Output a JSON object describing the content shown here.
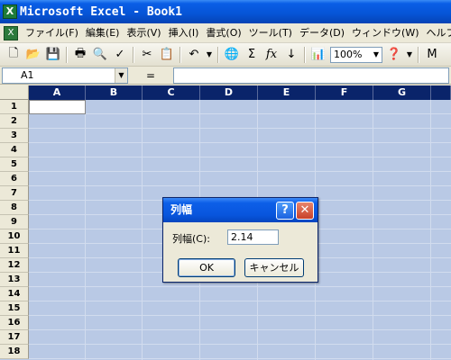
{
  "window": {
    "title": "Microsoft Excel - Book1",
    "app_icon": "excel-icon"
  },
  "menu": [
    "ファイル(F)",
    "編集(E)",
    "表示(V)",
    "挿入(I)",
    "書式(O)",
    "ツール(T)",
    "データ(D)",
    "ウィンドウ(W)",
    "ヘルプ(H)"
  ],
  "toolbar": {
    "zoom": "100%",
    "more_label": "M"
  },
  "formula_bar": {
    "name_box": "A1",
    "equals": "="
  },
  "sheet": {
    "columns": [
      "A",
      "B",
      "C",
      "D",
      "E",
      "F",
      "G"
    ],
    "rows": [
      "1",
      "2",
      "3",
      "4",
      "5",
      "6",
      "7",
      "8",
      "9",
      "10",
      "11",
      "12",
      "13",
      "14",
      "15",
      "16",
      "17",
      "18"
    ],
    "selection_color": "#b9c9e5",
    "header_highlight_color": "#0a246a"
  },
  "dialog": {
    "title": "列幅",
    "help_label": "?",
    "close_label": "✕",
    "field_label": "列幅(C):",
    "field_value": "2.14",
    "ok_label": "OK",
    "cancel_label": "キャンセル"
  }
}
